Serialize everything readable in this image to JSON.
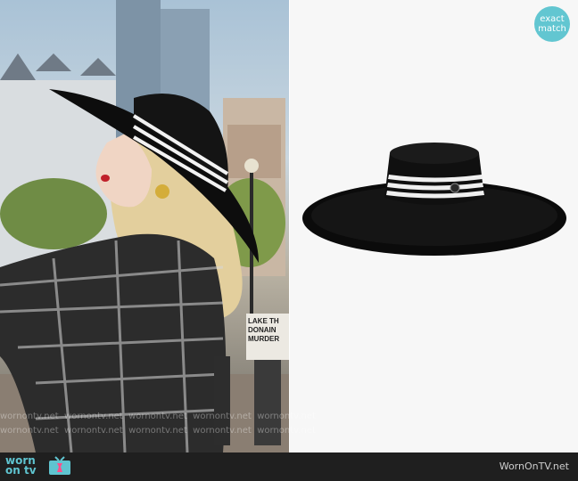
{
  "badge": {
    "line1": "exact",
    "line2": "match"
  },
  "footer": {
    "logo_text": "worn on tv",
    "site": "WornOnTV.net"
  },
  "scene": {
    "sign_line1": "LAKE TH",
    "sign_line2": "DONAIN",
    "sign_line3": "MURDER"
  },
  "watermark": "wornontv.net",
  "icons": [
    "tv-icon"
  ],
  "colors": {
    "accent": "#62c6d1",
    "hat": "#111111",
    "band_stripe": "#ffffff"
  }
}
